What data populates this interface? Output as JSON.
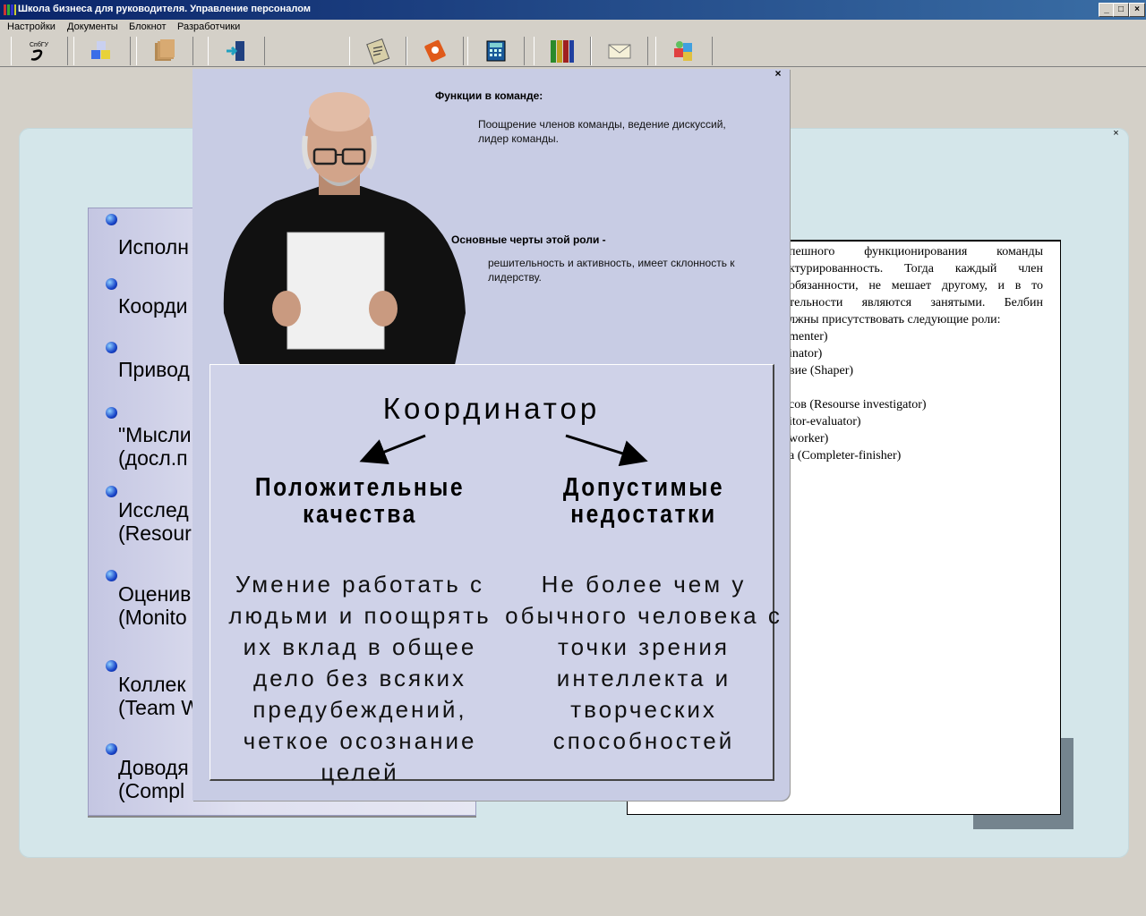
{
  "window": {
    "title": "Школа бизнеса для руководителя. Управление персоналом",
    "minimize": "_",
    "maximize": "□",
    "close": "×"
  },
  "menu": [
    "Настройки",
    "Документы",
    "Блокнот",
    "Разработчики"
  ],
  "toolbar": [
    {
      "name": "spb-logo-icon"
    },
    {
      "name": "blocks-icon"
    },
    {
      "name": "folders-icon"
    },
    {
      "name": "exit-door-icon"
    },
    {
      "name": "clipboard-icon"
    },
    {
      "name": "notebook-icon"
    },
    {
      "name": "calculator-icon"
    },
    {
      "name": "books-icon"
    },
    {
      "name": "envelope-icon"
    },
    {
      "name": "puzzle-icon"
    }
  ],
  "left_list": [
    "Исполн",
    "Коорди",
    "Привод",
    "\"Мысли\n(досл.п",
    "Исслед\n(Resour",
    "Оценив\n(Monito",
    "Коллек\n(Team W",
    "Доводя\n(Compl"
  ],
  "right_text": {
    "lines": [
      "пешного функционирования команды",
      "ктурированность. Тогда каждый член",
      "обязанности, не мешает другому, и в то",
      "тельности являются занятыми. Белбин",
      "лжны присутствовать следующие роли:"
    ],
    "roles": [
      "menter)",
      "inator)",
      "вие (Shaper)",
      "",
      "сов (Resourse investigator)",
      "itor-evaluator)",
      "worker)",
      "а (Completer-finisher)"
    ]
  },
  "popup": {
    "close": "×",
    "functions_title": "Функции в команде:",
    "functions_text": "Поощрение членов команды, ведение дискуссий, лидер команды.",
    "traits_title": "Основные черты этой роли -",
    "traits_text": "решительность и активность, имеет склонность к лидерству.",
    "role": "Координатор",
    "positive_head": "Положительные качества",
    "positive_body": "Умение работать с людьми и поощрять их вклад в общее дело без всяких предубеждений, четкое осознание целей",
    "negative_head": "Допустимые недостатки",
    "negative_body": "Не более чем у обычного человека с точки зрения интеллекта и творческих способностей"
  }
}
